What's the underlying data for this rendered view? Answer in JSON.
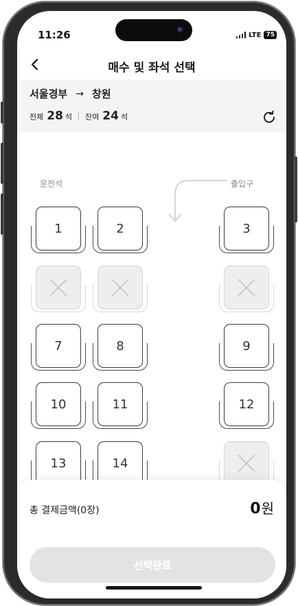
{
  "status_bar": {
    "time": "11:26",
    "network": "LTE",
    "battery": "75"
  },
  "header": {
    "title": "매수 및 좌석 선택"
  },
  "route": {
    "from": "서울경부",
    "arrow": "→",
    "to": "창원"
  },
  "counts": {
    "total_label": "전체",
    "total_value": "28",
    "total_unit": "석",
    "remain_label": "잔여",
    "remain_value": "24",
    "remain_unit": "석"
  },
  "labels": {
    "driver": "운전석",
    "entrance": "출입구"
  },
  "seats": [
    {
      "label": "1",
      "state": "available"
    },
    {
      "label": "2",
      "state": "available"
    },
    {
      "label": "3",
      "state": "available"
    },
    {
      "label": "",
      "state": "unavailable"
    },
    {
      "label": "",
      "state": "unavailable"
    },
    {
      "label": "",
      "state": "unavailable"
    },
    {
      "label": "7",
      "state": "available"
    },
    {
      "label": "8",
      "state": "available"
    },
    {
      "label": "9",
      "state": "available"
    },
    {
      "label": "10",
      "state": "available"
    },
    {
      "label": "11",
      "state": "available"
    },
    {
      "label": "12",
      "state": "available"
    },
    {
      "label": "13",
      "state": "available"
    },
    {
      "label": "14",
      "state": "available"
    },
    {
      "label": "",
      "state": "unavailable"
    }
  ],
  "footer": {
    "total_label": "총 결제금액(0장)",
    "total_amount": "0",
    "currency": "원",
    "submit_label": "선택완료"
  },
  "icons": {
    "back": "chevron-left-icon",
    "refresh": "refresh-icon",
    "unavailable": "x-icon",
    "entrance": "curved-arrow-down-icon"
  },
  "colors": {
    "seat_border": "#3a3a3a",
    "disabled_fill": "#eeeeee",
    "button_disabled": "#e3e3e3"
  }
}
